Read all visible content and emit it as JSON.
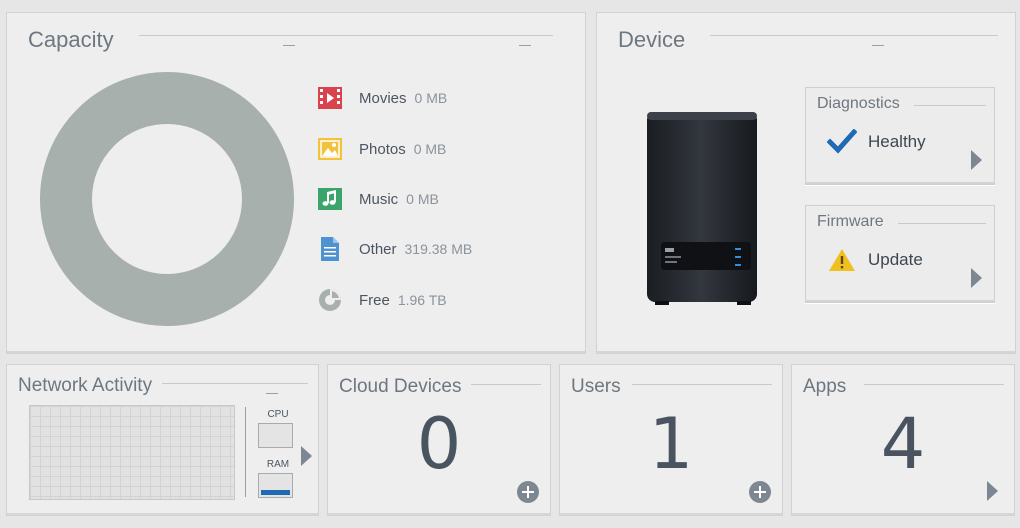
{
  "capacity": {
    "title": "Capacity",
    "legend": [
      {
        "label": "Movies",
        "value": "0 MB",
        "icon": "movies-icon",
        "color": "#d9434e"
      },
      {
        "label": "Photos",
        "value": "0 MB",
        "icon": "photos-icon",
        "color": "#f3c23c"
      },
      {
        "label": "Music",
        "value": "0 MB",
        "icon": "music-icon",
        "color": "#3aa46a"
      },
      {
        "label": "Other",
        "value": "319.38 MB",
        "icon": "document-icon",
        "color": "#4f92d0"
      },
      {
        "label": "Free",
        "value": "1.96 TB",
        "icon": "pie-chart-icon",
        "color": "#a8b0ae"
      }
    ],
    "donut_color": "#a8b0ae"
  },
  "device": {
    "title": "Device",
    "diagnostics": {
      "title": "Diagnostics",
      "status": "Healthy",
      "icon": "checkmark-icon",
      "color": "#1f6ab3"
    },
    "firmware": {
      "title": "Firmware",
      "status": "Update",
      "icon": "warning-icon",
      "color": "#f0c020"
    }
  },
  "network": {
    "title": "Network Activity",
    "cpu_label": "CPU",
    "ram_label": "RAM"
  },
  "cloud_devices": {
    "title": "Cloud Devices",
    "count": "0"
  },
  "users": {
    "title": "Users",
    "count": "1"
  },
  "apps": {
    "title": "Apps",
    "count": "4"
  }
}
